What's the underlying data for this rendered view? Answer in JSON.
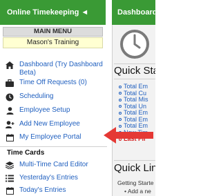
{
  "header": {
    "app_title": "Online Timekeeping ◄",
    "dashboard_title": "Dashboard"
  },
  "sidebar": {
    "menu_heading": "MAIN MENU",
    "org_name": "Mason's Training",
    "items": [
      {
        "label": "Dashboard (Try Dashboard",
        "label_line2": "Beta)",
        "icon": "home-icon"
      },
      {
        "label": "Time Off Requests (0)",
        "icon": "briefcase-icon"
      },
      {
        "label": "Scheduling",
        "icon": "clock-icon"
      },
      {
        "label": "Employee Setup",
        "icon": "person-icon"
      },
      {
        "label": "Add New Employee",
        "icon": "add-person-icon"
      },
      {
        "label": "My Employee Portal",
        "icon": "calendar-icon"
      }
    ],
    "time_cards": {
      "heading": "Time Cards",
      "items": [
        {
          "label": "Multi-Time Card Editor",
          "icon": "layers-icon"
        },
        {
          "label": "Yesterday's Entries",
          "icon": "list-icon"
        },
        {
          "label": "Today's Entries",
          "icon": "calendar-icon"
        }
      ]
    }
  },
  "dashboard": {
    "quick_stats_title": "Quick Stats",
    "stats": [
      "Total Em",
      "Total Cu",
      "Total Mis",
      "Total Un",
      "Total Em",
      "Total Em",
      "Total Em",
      "New Tim",
      "Last Fir"
    ],
    "quick_links_title": "Quick Lin",
    "getting_started": "Getting Starte",
    "add_line": "Add a ne"
  },
  "colors": {
    "brand_green": "#3a9a35",
    "link_blue": "#1f5fbf",
    "alert_red": "#d51f1f",
    "arrow_red": "#e53935"
  }
}
